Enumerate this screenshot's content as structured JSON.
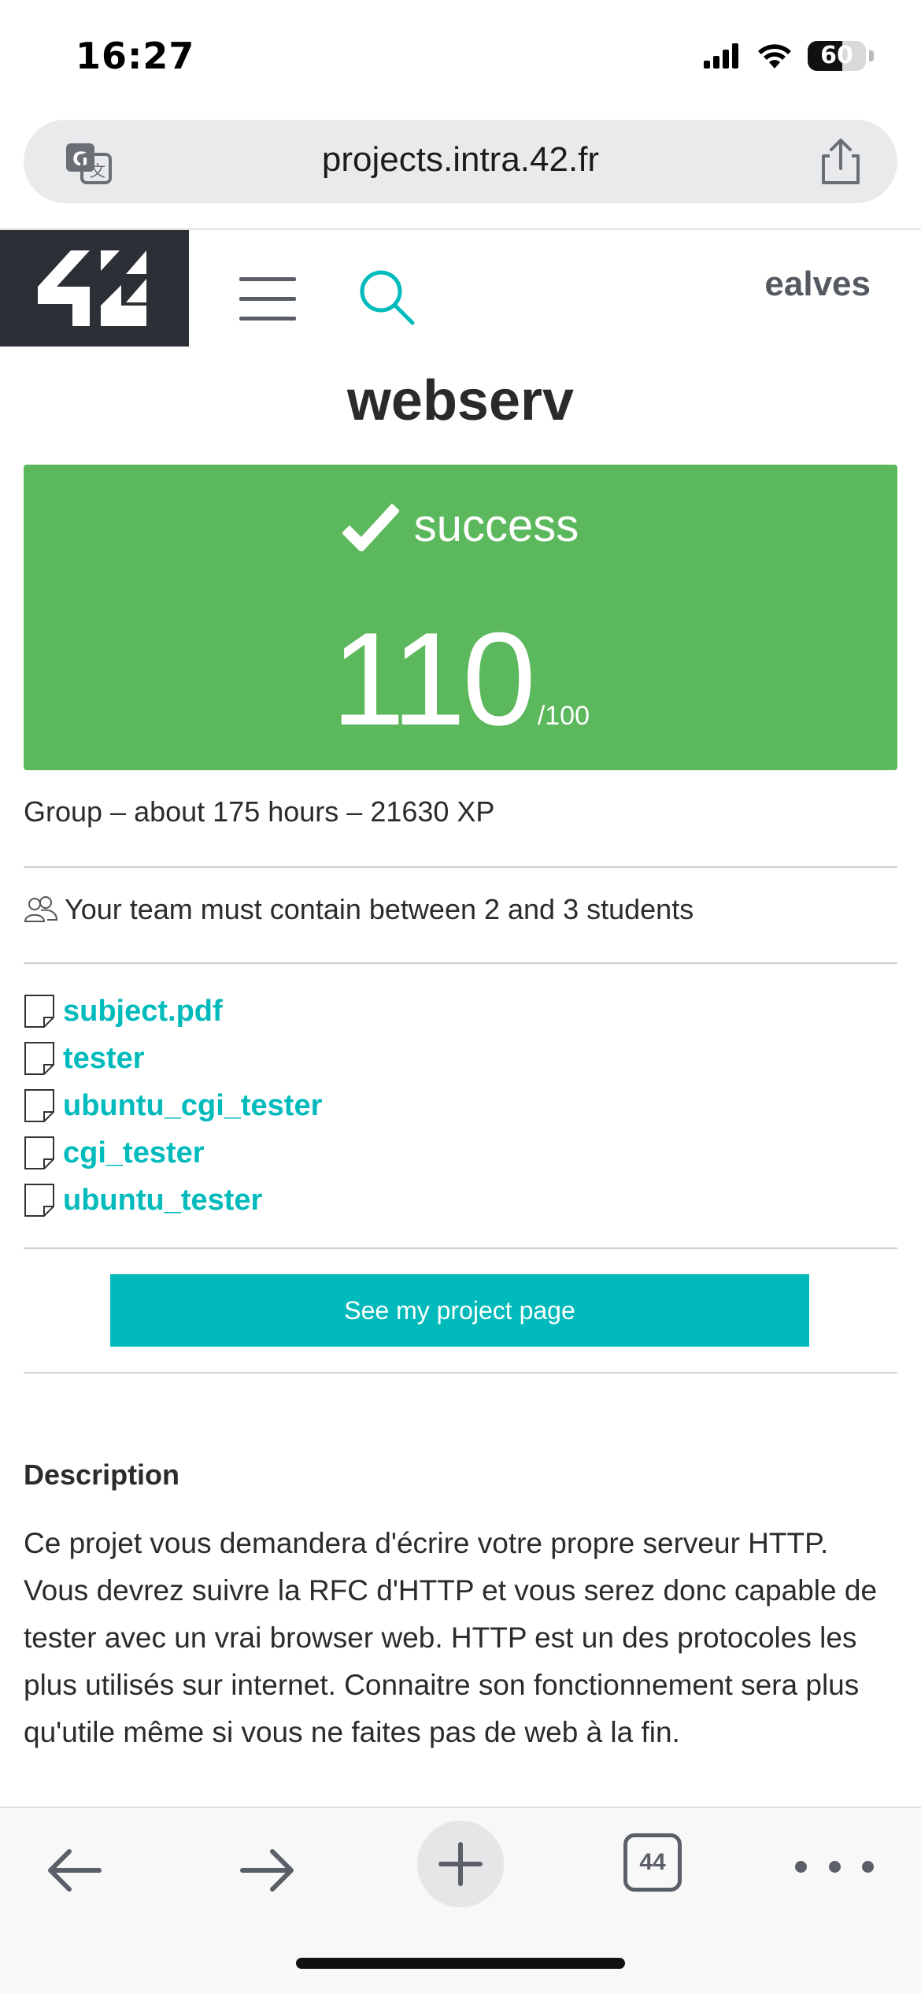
{
  "status_bar": {
    "time": "16:27",
    "battery": "60",
    "icons": [
      "signal-icon",
      "wifi-icon",
      "battery-icon"
    ]
  },
  "browser": {
    "url": "projects.intra.42.fr",
    "icons": [
      "translate-icon",
      "share-icon"
    ]
  },
  "header": {
    "logo": "42",
    "username": "ealves",
    "icons": [
      "menu-icon",
      "search-icon"
    ]
  },
  "project": {
    "title": "webserv",
    "status": "success",
    "grade": "110",
    "grade_max": "/100",
    "info": "Group – about 175 hours – 21630 XP",
    "team_rule": "Your team must contain between 2 and 3 students",
    "attachments": [
      {
        "label": "subject.pdf"
      },
      {
        "label": "tester"
      },
      {
        "label": "ubuntu_cgi_tester"
      },
      {
        "label": "cgi_tester"
      },
      {
        "label": "ubuntu_tester"
      }
    ],
    "button_label": "See my project page",
    "description_title": "Description",
    "description": "Ce projet vous demandera d'écrire votre propre serveur HTTP. Vous devrez suivre la RFC d'HTTP et vous serez donc capable de tester avec un vrai browser web. HTTP est un des protocoles les plus utilisés sur internet. Connaitre son fonctionnement sera plus qu'utile même si vous ne faites pas de web à la fin."
  },
  "toolbar": {
    "tabs_count": "44",
    "icons": [
      "back-arrow-icon",
      "forward-arrow-icon",
      "plus-icon",
      "tabs-icon",
      "more-icon"
    ]
  },
  "colors": {
    "accent": "#00babc",
    "success": "#5cb85c",
    "logo_bg": "#2c2f36"
  }
}
